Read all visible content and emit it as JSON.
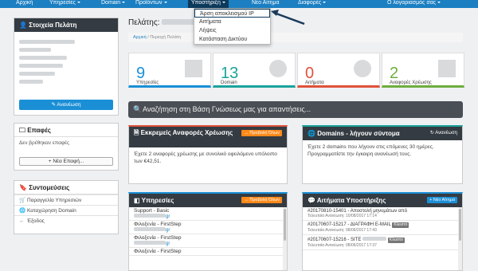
{
  "nav": {
    "items": [
      "Αρχική",
      "Υπηρεσίες",
      "Domain",
      "Προϊόντων",
      "Υποστήριξη",
      "Νέο Αίτημα",
      "Διαφορές",
      "Ο λογαριασμός σας"
    ],
    "dropdown": [
      "Άρση αποκλεισμού IP",
      "Αιτήματα",
      "Λήψεις",
      "Κατάσταση Δικτύου"
    ]
  },
  "sidebar": {
    "client_title": "Στοιχεία Πελάτη",
    "update_button": "✎ Ανανέωση",
    "contacts_title": "Επαφές",
    "contacts_empty": "Δεν βρέθηκαν επαφές",
    "new_contact_button": "+ Νέα Επαφή...",
    "shortcuts_title": "Συντομεύσεις",
    "shortcuts": [
      {
        "icon": "🛒",
        "label": "Παραγγελία Υπηρεσιών"
      },
      {
        "icon": "🌐",
        "label": "Καταχώρηση Domain"
      },
      {
        "icon": "←",
        "label": "Έξοδος"
      }
    ]
  },
  "header": {
    "title": "Πελάτης:",
    "breadcrumb_home": "Αρχική",
    "breadcrumb_current": "Περιοχή Πελάτη"
  },
  "stats": [
    {
      "value": "9",
      "label": "Υπηρεσίες",
      "color": "#1b8fd6"
    },
    {
      "value": "13",
      "label": "Domain",
      "color": "#1aa39a"
    },
    {
      "value": "0",
      "label": "Αιτήματα",
      "color": "#e0523c"
    },
    {
      "value": "2",
      "label": "Αναφορές Χρέωσης",
      "color": "#6dae3d"
    }
  ],
  "knowledgebase": {
    "placeholder": "Αναζήτηση στη Βάση Γνώσεως μας για απαντήσεις..."
  },
  "invoices": {
    "title": "Εκκρεμείς Αναφορές Χρέωσης",
    "badge": "→ Προβολή Όλων",
    "text": "Έχετε 2 αναφορές χρέωσης με συνολικό οφειλόμενο υπόλοιπο των €42,51."
  },
  "domains": {
    "title": "Domains - λήγουν σύντομα",
    "badge": "↻ Ανανέωση",
    "text": "Έχετε 2 domains που λήγουν στις επόμενες 30 ημέρες. Προγραμματίστε την έγκαιρη ανανέωσή τους."
  },
  "services": {
    "title": "Υπηρεσίες",
    "badge": "→ Προβολή Όλων",
    "items": [
      {
        "name": "Support - Basic",
        "domain": "gr"
      },
      {
        "name": "Φιλοξενία - FirstStep",
        "domain": "gr"
      },
      {
        "name": "Φιλοξενία - FirstStep",
        "domain": "gr"
      },
      {
        "name": "Φιλοξενία - FirstStep",
        "domain": ""
      }
    ]
  },
  "tickets": {
    "title": "Αιτήματα Υποστήριξης",
    "badge": "+ Νέο Αίτημα",
    "items": [
      {
        "title": "#20170810-15401 - Αποστολή μηνυμάτων από",
        "status": "",
        "updated": "Τελευταία Ανανέωση: 10/08/2017 17:14"
      },
      {
        "title": "#20170607-15217 - ΔΙΑΓΡΑΦΗ E-MAIL",
        "status": "Κλειστό",
        "updated": "Τελευταία Ανανέωση: 08/06/2017 17:43"
      },
      {
        "title": "#20170607-15216 - SITE",
        "status": "Κλειστό",
        "updated": "Τελευταία Ανανέωση: 08/06/2017 17:37"
      }
    ]
  }
}
